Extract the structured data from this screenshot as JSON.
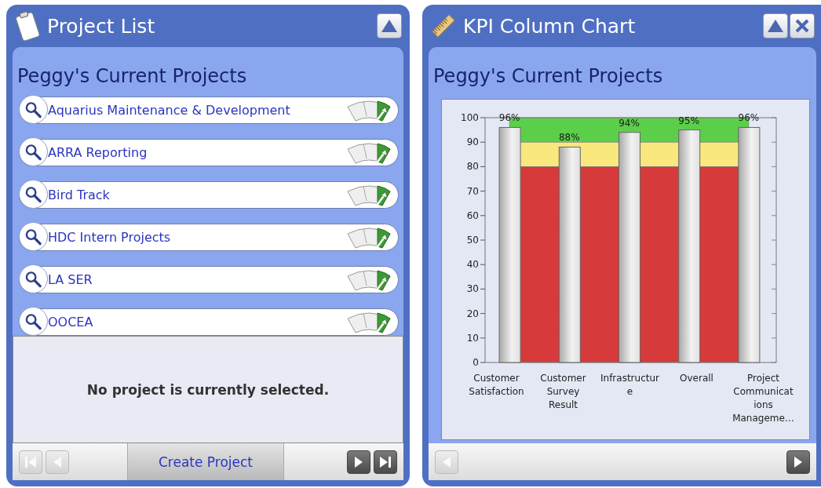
{
  "panels": [
    {
      "kind": "list",
      "title": "Project List",
      "closable": false,
      "heading": "Peggy's Current Projects",
      "projects": [
        {
          "name": "Aquarius Maintenance & Development"
        },
        {
          "name": "ARRA Reporting"
        },
        {
          "name": "Bird Track"
        },
        {
          "name": "HDC Intern Projects"
        },
        {
          "name": "LA SER"
        },
        {
          "name": "OOCEA"
        }
      ],
      "detail_message": "No project is currently selected.",
      "footer_button": "Create Project",
      "nav_buttons": [
        {
          "kind": "first",
          "disabled": true
        },
        {
          "kind": "prev",
          "disabled": true
        },
        {
          "kind": "next",
          "disabled": false
        },
        {
          "kind": "last",
          "disabled": false
        }
      ]
    },
    {
      "kind": "chart",
      "title": "KPI Column Chart",
      "closable": true,
      "heading": "Peggy's Current Projects",
      "chart_data": {
        "type": "bar",
        "categories": [
          "Customer Satisfaction",
          "Customer Survey Result",
          "Infrastructure",
          "Overall",
          "Project Communications Manageme…"
        ],
        "series": [
          {
            "values": [
              96,
              88,
              94,
              95,
              96
            ]
          }
        ],
        "ylim": [
          0,
          100
        ],
        "yticks": [
          0,
          10,
          20,
          30,
          40,
          50,
          60,
          70,
          80,
          90,
          100
        ],
        "value_labels": [
          "96%",
          "88%",
          "94%",
          "95%",
          "96%"
        ],
        "bands": [
          {
            "axis": "y",
            "from": 90,
            "to": 100,
            "color": "#5ccf4a"
          },
          {
            "axis": "y",
            "from": 80,
            "to": 90,
            "color": "#f8e87e"
          },
          {
            "axis": "y",
            "from": 0,
            "to": 80,
            "color": "#d63a3a"
          }
        ]
      },
      "nav_buttons": [
        {
          "kind": "prev",
          "disabled": true
        },
        {
          "kind": "next",
          "disabled": false
        }
      ]
    }
  ]
}
